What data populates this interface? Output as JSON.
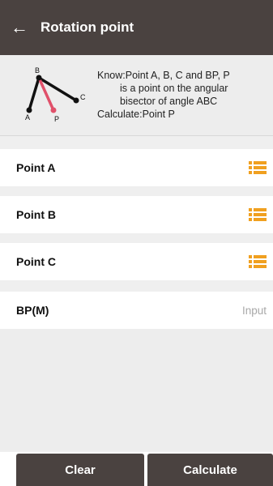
{
  "header": {
    "back_icon": "arrow-left-icon",
    "back_glyph": "←",
    "title": "Rotation point"
  },
  "diagram": {
    "labels": {
      "a": "A",
      "b": "B",
      "c": "C",
      "p": "P"
    },
    "colors": {
      "lines": "#111111",
      "bisector": "#e0506a"
    }
  },
  "info": {
    "line1": "Know:Point A, B, C and BP, P",
    "line2": "is a point on the angular",
    "line3": "bisector of angle ABC",
    "line4": "Calculate:Point P"
  },
  "form": {
    "point_a": {
      "label": "Point A",
      "icon": "list-icon"
    },
    "point_b": {
      "label": "Point B",
      "icon": "list-icon"
    },
    "point_c": {
      "label": "Point C",
      "icon": "list-icon"
    },
    "bp": {
      "label": "BP(M)",
      "value": "",
      "placeholder": "Input"
    }
  },
  "actions": {
    "clear_label": "Clear",
    "calculate_label": "Calculate"
  },
  "colors": {
    "header_bg": "#4a4240",
    "accent_icon": "#f0a020",
    "background": "#ededed"
  }
}
